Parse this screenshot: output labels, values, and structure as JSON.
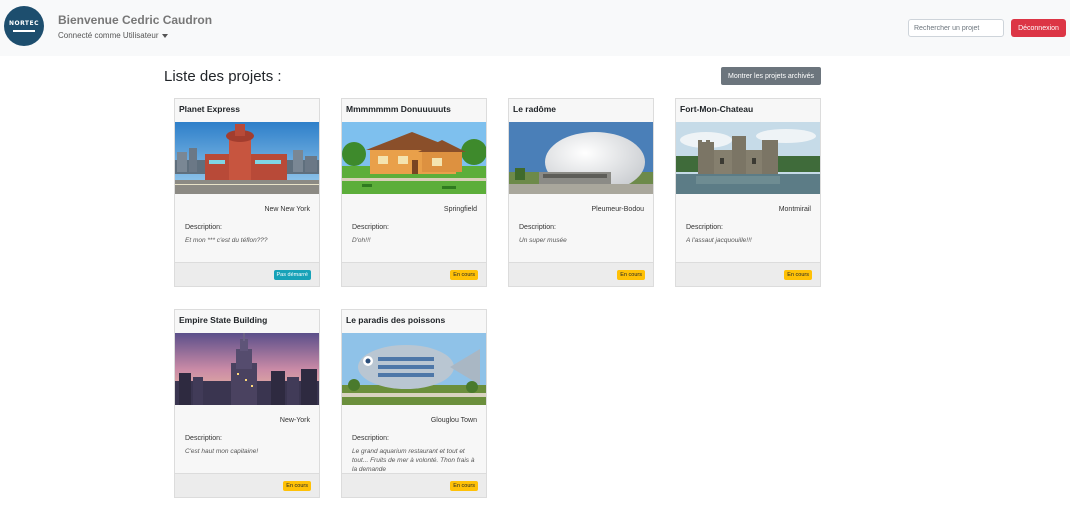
{
  "header": {
    "logo_text": "NORTEC",
    "welcome": "Bienvenue Cedric Caudron",
    "connected_as": "Connecté comme Utilisateur",
    "search_placeholder": "Rechercher un projet",
    "logout_label": "Déconnexion"
  },
  "main": {
    "title": "Liste des projets :",
    "archived_button": "Montrer les projets archivés",
    "desc_label": "Description:"
  },
  "projects": [
    {
      "name": "Planet Express",
      "location": "New New York",
      "description": "Et mon *** c'est du téflon???",
      "status": "Pas démarré",
      "status_color": "#17a2b8",
      "image": "planet-express"
    },
    {
      "name": "Mmmmmmm Donuuuuuts",
      "location": "Springfield",
      "description": "D'oh!!!",
      "status": "En cours",
      "status_color": "#ffc107",
      "image": "simpsons-house"
    },
    {
      "name": "Le radôme",
      "location": "Pleumeur-Bodou",
      "description": "Un super musée",
      "status": "En cours",
      "status_color": "#ffc107",
      "image": "radome"
    },
    {
      "name": "Fort-Mon-Chateau",
      "location": "Montmirail",
      "description": "A l'assaut jacquouille!!!",
      "status": "En cours",
      "status_color": "#ffc107",
      "image": "castle"
    },
    {
      "name": "Empire State Building",
      "location": "New-York",
      "description": "C'est haut mon capitaine!",
      "status": "En cours",
      "status_color": "#ffc107",
      "image": "empire-state"
    },
    {
      "name": "Le paradis des poissons",
      "location": "Glouglou Town",
      "description": "Le grand aquarium restaurant et tout et tout... Fruits de mer à volonté. Thon frais à la demande",
      "status": "En cours",
      "status_color": "#ffc107",
      "image": "fish-building"
    }
  ]
}
